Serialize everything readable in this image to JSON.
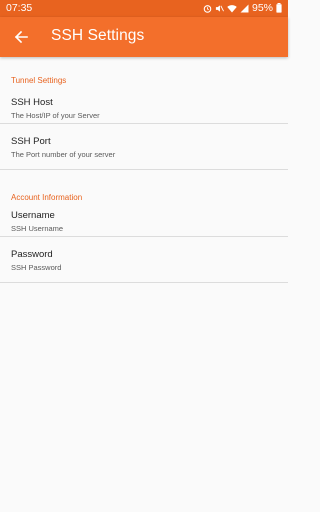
{
  "status_bar": {
    "time": "07:35",
    "battery": "95%",
    "icons": [
      "alarm-icon",
      "mute-icon",
      "wifi-icon",
      "signal-icon",
      "battery-icon"
    ]
  },
  "app_bar": {
    "title": "SSH Settings",
    "back_icon": "arrow-left-icon",
    "color": "#f36f2b"
  },
  "sections": {
    "tunnel": {
      "header": "Tunnel Settings",
      "host": {
        "title": "SSH Host",
        "summary": "The Host/IP of your Server"
      },
      "port": {
        "title": "SSH Port",
        "summary": "The Port number of your server"
      }
    },
    "account": {
      "header": "Account Information",
      "username": {
        "title": "Username",
        "summary": "SSH Username"
      },
      "password": {
        "title": "Password",
        "summary": "SSH Password"
      }
    }
  },
  "accent_color": "#e8631f"
}
